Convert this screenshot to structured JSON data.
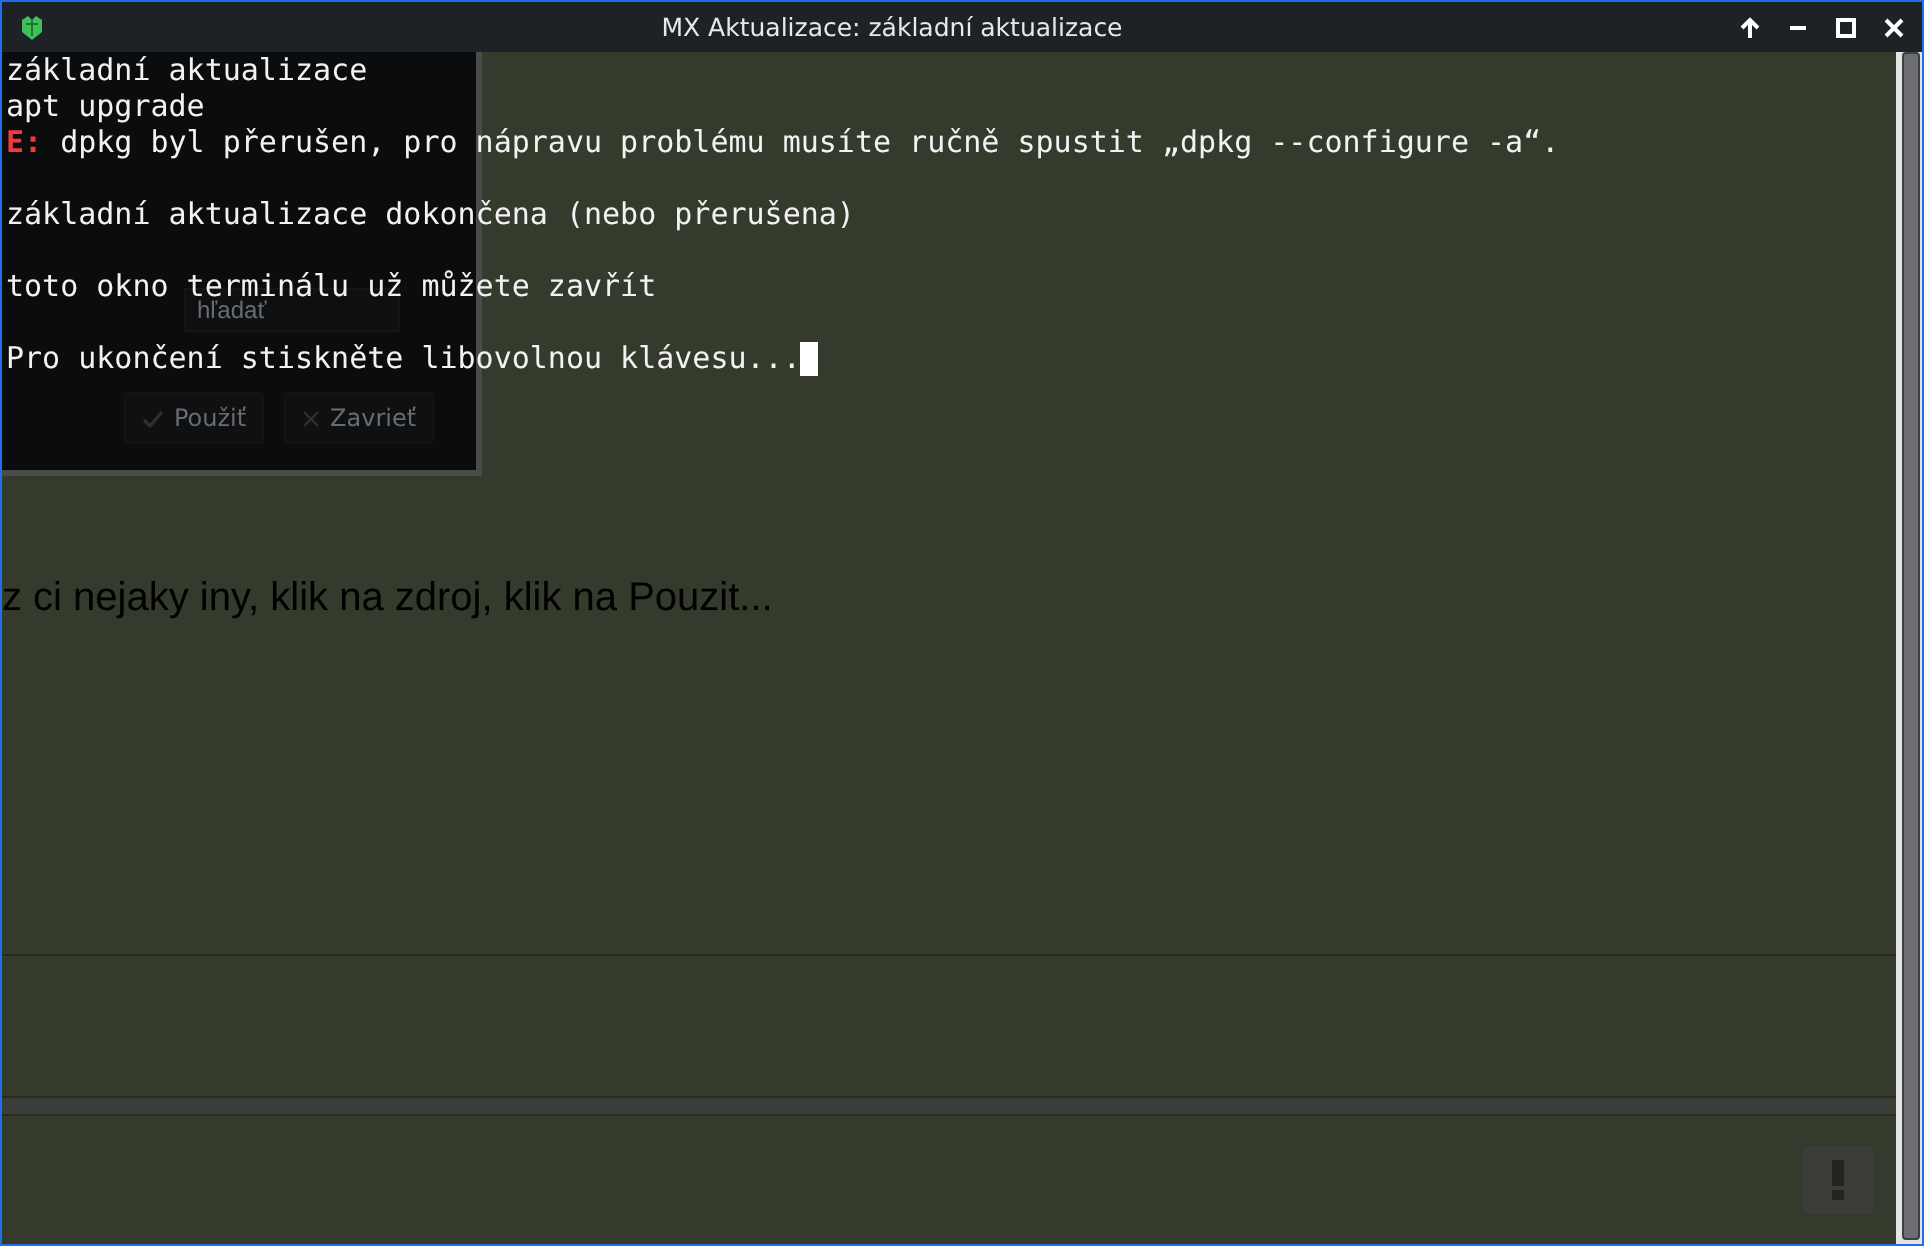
{
  "window": {
    "title": "MX Aktualizace: základní aktualizace"
  },
  "terminal": {
    "lines": [
      {
        "kind": "plain",
        "text": "základní aktualizace"
      },
      {
        "kind": "plain",
        "text": "apt upgrade"
      },
      {
        "kind": "error",
        "prefix": "E:",
        "text": " dpkg byl přerušen, pro nápravu problému musíte ručně spustit „dpkg --configure -a“."
      },
      {
        "kind": "blank"
      },
      {
        "kind": "plain",
        "text": "základní aktualizace dokončena (nebo přerušena)"
      },
      {
        "kind": "blank"
      },
      {
        "kind": "plain",
        "text": "toto okno terminálu už můžete zavřít"
      },
      {
        "kind": "blank"
      },
      {
        "kind": "prompt",
        "text": "Pro ukončení stiskněte libovolnou klávesu..."
      }
    ]
  },
  "background_window": {
    "search": {
      "placeholder": "hľadať"
    },
    "buttons": [
      {
        "kind": "apply",
        "label": "Použiť"
      },
      {
        "kind": "close",
        "label": "Zavrieť"
      }
    ],
    "message": "z ci nejaky iny, klik na zdroj, klik na Pouzit..."
  }
}
